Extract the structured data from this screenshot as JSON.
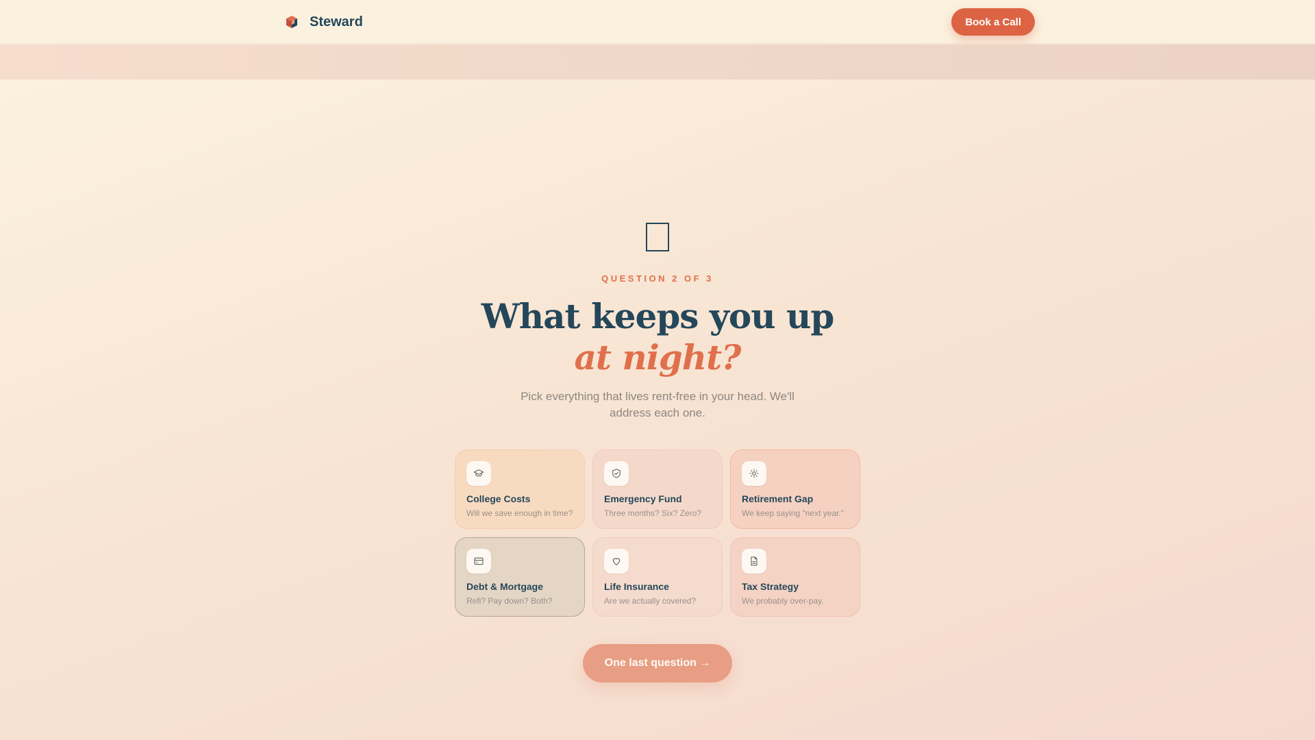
{
  "header": {
    "brand_name": "Steward",
    "brand_icon": "cube-logo-icon",
    "cta_label": "Book a Call"
  },
  "hero": {
    "icon": "missing-glyph-icon",
    "eyebrow": "QUESTION 2 OF 3",
    "title_line1": "What keeps you up",
    "title_line2": "at night?",
    "subtitle": "Pick everything that lives rent-free in your head. We'll address each one."
  },
  "options": [
    {
      "title": "College Costs",
      "desc": "Will we save enough in time?",
      "icon": "graduation-cap-icon"
    },
    {
      "title": "Emergency Fund",
      "desc": "Three months? Six? Zero?",
      "icon": "shield-check-icon"
    },
    {
      "title": "Retirement Gap",
      "desc": "We keep saying \"next year.\"",
      "icon": "sun-icon"
    },
    {
      "title": "Debt & Mortgage",
      "desc": "Refi? Pay down? Both?",
      "icon": "credit-card-icon"
    },
    {
      "title": "Life Insurance",
      "desc": "Are we actually covered?",
      "icon": "heart-icon"
    },
    {
      "title": "Tax Strategy",
      "desc": "We probably over-pay.",
      "icon": "document-icon"
    }
  ],
  "next_button": {
    "label": "One last question →"
  },
  "colors": {
    "accent": "#dc6444",
    "navy": "#24475a",
    "muted": "#8c8784"
  }
}
